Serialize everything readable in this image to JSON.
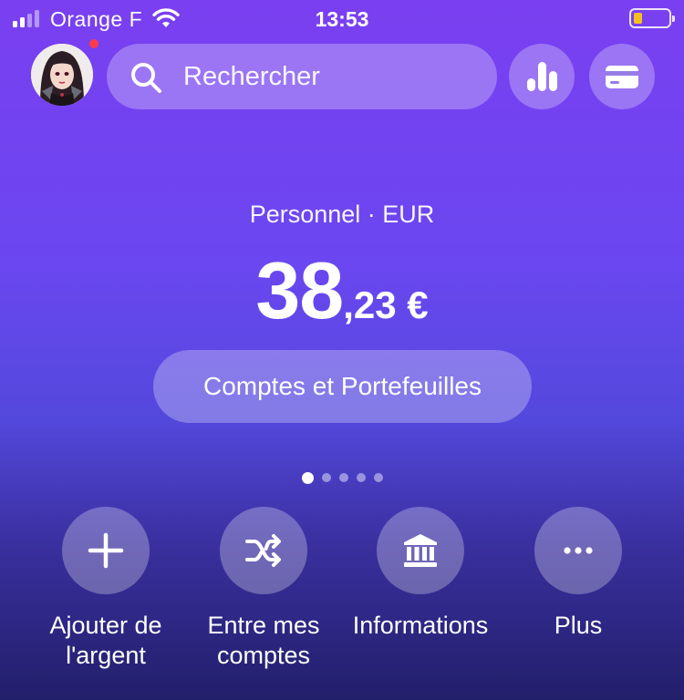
{
  "status_bar": {
    "carrier": "Orange F",
    "time": "13:53"
  },
  "search": {
    "placeholder": "Rechercher"
  },
  "account": {
    "label": "Personnel · EUR",
    "balance_integer": "38",
    "balance_decimal": ",23 €"
  },
  "accounts_button": {
    "label": "Comptes et Portefeuilles"
  },
  "pager": {
    "count": 5,
    "active_index": 0
  },
  "actions": [
    {
      "label": "Ajouter de\nl'argent",
      "icon": "plus-icon"
    },
    {
      "label": "Entre mes\ncomptes",
      "icon": "shuffle-icon"
    },
    {
      "label": "Informations",
      "icon": "bank-icon"
    },
    {
      "label": "Plus",
      "icon": "more-icon"
    }
  ],
  "colors": {
    "gradient_top": "#7a3ff0",
    "gradient_bottom": "#221f6a",
    "notification_dot": "#ff3b4b",
    "battery_level": "#f2c01e"
  }
}
